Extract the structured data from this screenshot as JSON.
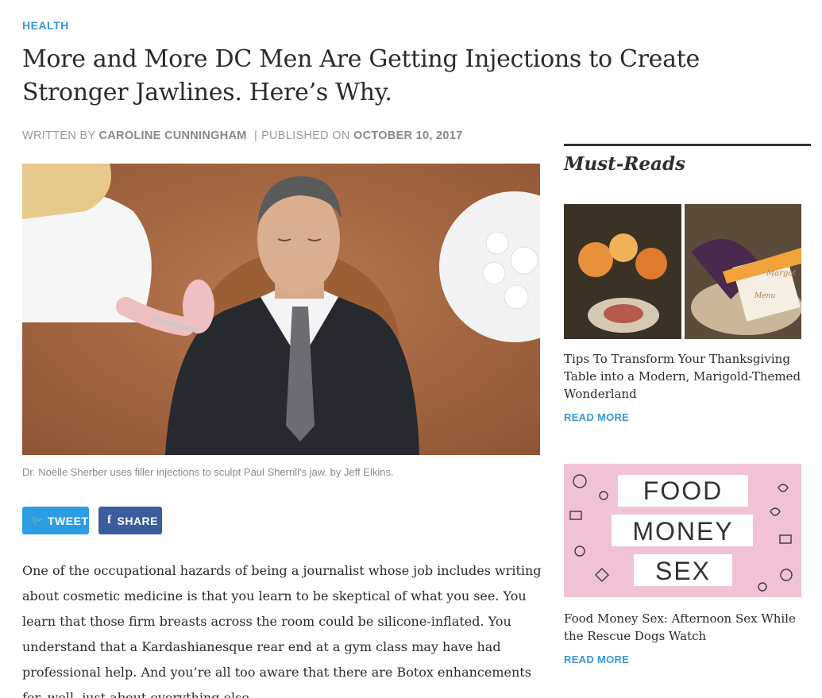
{
  "article": {
    "category": "HEALTH",
    "headline": "More and More DC Men Are Getting Injections to Create Stronger Jawlines. Here’s Why.",
    "byline": {
      "written_by_label": "WRITTEN BY",
      "author": "CAROLINE CUNNINGHAM",
      "separator": "|",
      "published_label": "PUBLISHED ON",
      "date": "OCTOBER 10, 2017"
    },
    "image_caption": "Dr. Noëlle Sherber uses filler injections to sculpt Paul Sherrill's jaw. by Jeff Elkins.",
    "share": {
      "tweet_label": "TWEET",
      "tweet_icon": "twitter-bird-icon",
      "share_label": "SHARE",
      "share_icon": "facebook-f-icon"
    },
    "body": "One of the occupational hazards of being a journalist whose job includes writing about cosmetic medicine is that you learn to be skeptical of what you see. You learn that those firm breasts across the room could be silicone-inflated. You understand that a Kardashianesque rear end at a gym class may have had professional help. And you’re all too aware that there are Botox enhancements for, well, just about everything else."
  },
  "sidebar": {
    "title": "Must-Reads",
    "cards": [
      {
        "title": "Tips To Transform Your Thanksgiving Table into a Modern, Marigold-Themed Wonderland",
        "read_more": "READ MORE",
        "image_text": [
          "Margot",
          "Menu"
        ]
      },
      {
        "title": "Food Money Sex: Afternoon Sex While the Rescue Dogs Watch",
        "read_more": "READ MORE",
        "image_text": [
          "FOOD",
          "MONEY",
          "SEX"
        ]
      }
    ]
  },
  "colors": {
    "accent_blue": "#3a96d6",
    "twitter_blue": "#2d9de3",
    "facebook_blue": "#3b5c9d",
    "food_money_sex_pink": "#f1c2d6"
  }
}
